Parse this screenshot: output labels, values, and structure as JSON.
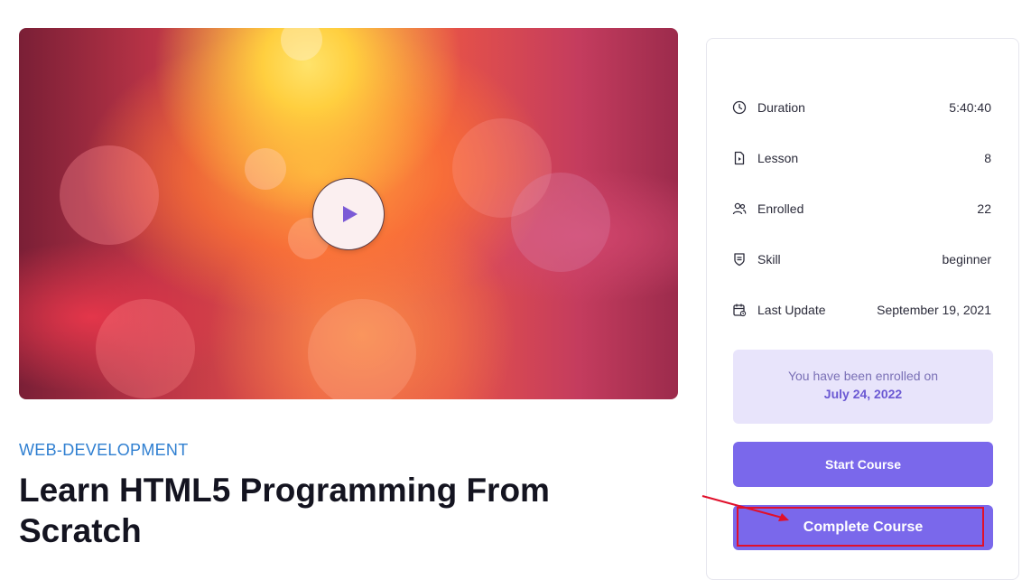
{
  "video": {
    "play_icon": "play-icon"
  },
  "course": {
    "category": "WEB-DEVELOPMENT",
    "title": "Learn HTML5 Programming From Scratch"
  },
  "sidebar": {
    "info": [
      {
        "icon": "clock-icon",
        "label": "Duration",
        "value": "5:40:40"
      },
      {
        "icon": "lesson-file-icon",
        "label": "Lesson",
        "value": "8"
      },
      {
        "icon": "users-icon",
        "label": "Enrolled",
        "value": "22"
      },
      {
        "icon": "skill-badge-icon",
        "label": "Skill",
        "value": "beginner"
      },
      {
        "icon": "calendar-icon",
        "label": "Last Update",
        "value": "September 19, 2021"
      }
    ],
    "enrolled_text": "You have been enrolled on",
    "enrolled_date": "July 24, 2022",
    "start_button": "Start Course",
    "complete_button": "Complete Course"
  },
  "colors": {
    "accent": "#7a68eb",
    "category": "#2f7fd1",
    "enrolled_bg": "#e8e4fb",
    "annotation": "#e0102b"
  }
}
